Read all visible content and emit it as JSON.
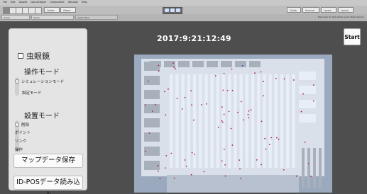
{
  "editor": {
    "menu": [
      "File",
      "Edit",
      "Assets",
      "GameObject",
      "Component",
      "Window",
      "Help"
    ],
    "toolbar_center": "Center",
    "toolbar_global": "Global",
    "toolbar_right": [
      "Collab",
      "Account",
      "Layers",
      "Layout"
    ],
    "tabs": [
      "Scene",
      "Game",
      "Asset Store"
    ],
    "display_info": "Maximize On Play  Mute Audio  Stats  Gizmos"
  },
  "panel": {
    "fisheye_label": "虫眼鏡",
    "fisheye_checked": false,
    "op_mode_title": "操作モード",
    "op_modes": [
      "シミュレーションモード",
      "設定モード"
    ],
    "setup_mode_title": "設置モード",
    "setup_modes": [
      "削除",
      "ポイント",
      "リンク",
      "操作"
    ],
    "save_map_label": "マップデータ保存",
    "load_idpos_label": "ID-POSデータ読み込み"
  },
  "game": {
    "clock": "2017:9:21:12:49",
    "start_label": "Start",
    "colors": {
      "background": "#4e4e4e",
      "floor": "#9aa9bd",
      "shelf": "#e8eef7",
      "shelf_gray": "#a8b0bc",
      "agent_red": "#b02040",
      "agent_blue": "#2040c0"
    }
  }
}
